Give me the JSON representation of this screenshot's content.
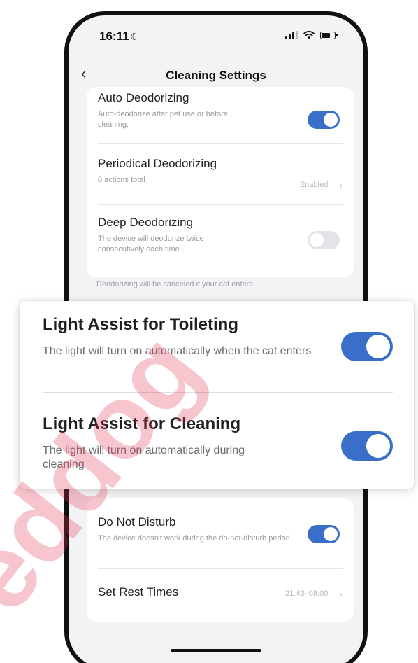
{
  "status_bar": {
    "time": "16:11",
    "moon": "☾"
  },
  "nav": {
    "back_glyph": "‹",
    "title": "Cleaning Settings"
  },
  "deodorize_card": {
    "auto": {
      "title": "Auto Deodorizing",
      "desc": "Auto-deodorize after pet use or before cleaning.",
      "enabled": true
    },
    "periodical": {
      "title": "Periodical Deodorizing",
      "desc": "0 actions total",
      "value": "Enabled",
      "chevron": "›"
    },
    "deep": {
      "title": "Deep Deodorizing",
      "desc": "The device will deodorize twice consecutively each time.",
      "enabled": false
    }
  },
  "footnote": "Deodorizing will be canceled if your cat enters.",
  "light_assist": {
    "toileting": {
      "title": "Light Assist for Toileting",
      "desc": "The light will turn on automatically when the cat enters",
      "enabled": true
    },
    "cleaning": {
      "title": "Light Assist for Cleaning",
      "desc": "The light will turn on automatically during cleaning",
      "enabled": true
    }
  },
  "dnd_card": {
    "dnd": {
      "title": "Do Not Disturb",
      "desc": "The device doesn't work during the do-not-disturb period",
      "enabled": true
    },
    "rest_times": {
      "title": "Set Rest Times",
      "value": "21:43–08:00",
      "chevron": "›"
    }
  },
  "colors": {
    "accent": "#3a6fc9",
    "watermark": "#e0314f"
  }
}
